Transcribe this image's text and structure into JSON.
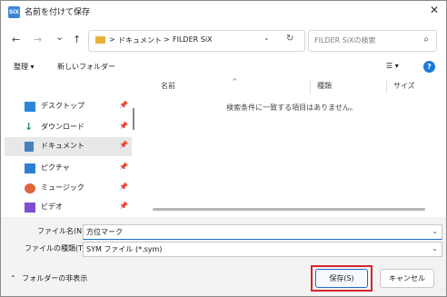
{
  "window": {
    "app_icon_text": "SiX",
    "title": "名前を付けて保存",
    "close_glyph": "✕"
  },
  "nav": {
    "back_glyph": "←",
    "forward_glyph": "→",
    "recent_glyph": "⌄",
    "up_glyph": "↑",
    "breadcrumb": [
      "ドキュメント",
      "FILDER SiX"
    ],
    "crumb_sep": ">",
    "address_dropdown_glyph": "⌄",
    "refresh_glyph": "↻",
    "search_placeholder": "FILDER SiXの検索",
    "search_glyph": "⌕"
  },
  "toolbar": {
    "organize_label": "整理 ▾",
    "new_folder_label": "新しいフォルダー",
    "view_glyph": "☰ ▾",
    "help_glyph": "?"
  },
  "sidebar": {
    "items": [
      {
        "label": "デスクトップ",
        "icon": "desktop-icon",
        "color": "#2b86d8"
      },
      {
        "label": "ダウンロード",
        "icon": "download-icon",
        "color": "#1f9a5a"
      },
      {
        "label": "ドキュメント",
        "icon": "documents-icon",
        "color": "#4a7fc1"
      },
      {
        "label": "ピクチャ",
        "icon": "pictures-icon",
        "color": "#2d7fd2"
      },
      {
        "label": "ミュージック",
        "icon": "music-icon",
        "color": "#e0643a"
      },
      {
        "label": "ビデオ",
        "icon": "video-icon",
        "color": "#7d4fd0"
      }
    ],
    "pin_glyph": "📌",
    "selected_index": 2
  },
  "file_list": {
    "sort_glyph": "^",
    "columns": [
      "名前",
      "種類",
      "サイズ"
    ],
    "empty_message": "検索条件に一致する項目はありません。"
  },
  "form": {
    "filename_label": "ファイル名(N):",
    "filename_value": "方位マーク",
    "filetype_label": "ファイルの種類(T):",
    "filetype_value": "SYM ファイル (*.sym)",
    "dropdown_glyph": "⌄"
  },
  "footer": {
    "hide_folders_label": "フォルダーの非表示",
    "hide_folders_glyph": "⌃",
    "save_label": "保存(S)",
    "cancel_label": "キャンセル",
    "highlight_color": "#d9232d"
  }
}
